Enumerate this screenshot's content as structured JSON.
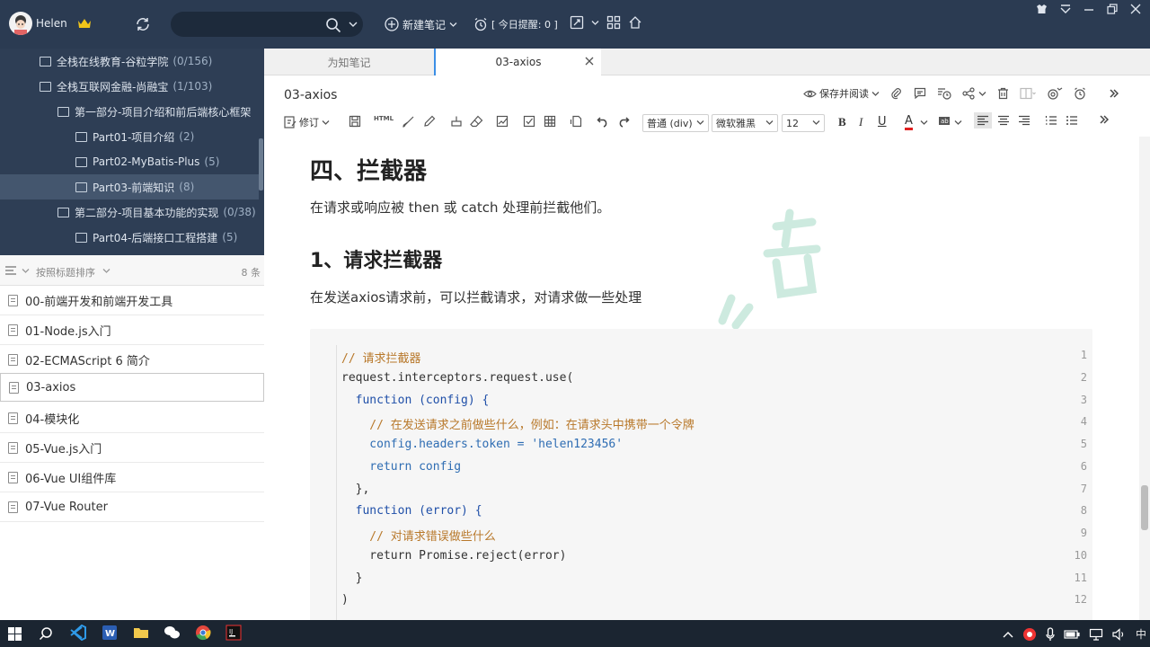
{
  "topbar": {
    "username": "Helen",
    "new_note_label": "新建笔记",
    "reminder_label": "[ 今日提醒: 0 ]"
  },
  "tree": {
    "items": [
      {
        "label": "全栈在线教育-谷粒学院",
        "count": "(0/156)",
        "level": 1
      },
      {
        "label": "全栈互联网金融-尚融宝",
        "count": "(1/103)",
        "level": 1
      },
      {
        "label": "第一部分-项目介绍和前后端核心框架",
        "count": "",
        "level": 2
      },
      {
        "label": "Part01-项目介绍",
        "count": "(2)",
        "level": 3
      },
      {
        "label": "Part02-MyBatis-Plus",
        "count": "(5)",
        "level": 3
      },
      {
        "label": "Part03-前端知识",
        "count": "(8)",
        "level": 3,
        "selected": true
      },
      {
        "label": "第二部分-项目基本功能的实现",
        "count": "(0/38)",
        "level": 2
      },
      {
        "label": "Part04-后端接口工程搭建",
        "count": "(5)",
        "level": 3
      }
    ]
  },
  "sortbar": {
    "label": "按照标题排序",
    "count": "8 条"
  },
  "notes": [
    {
      "title": "00-前端开发和前端开发工具"
    },
    {
      "title": "01-Node.js入门"
    },
    {
      "title": "02-ECMAScript 6 简介"
    },
    {
      "title": "03-axios",
      "selected": true
    },
    {
      "title": "04-模块化"
    },
    {
      "title": "05-Vue.js入门"
    },
    {
      "title": "06-Vue UI组件库"
    },
    {
      "title": "07-Vue Router"
    }
  ],
  "tabs": {
    "tab1": "为知笔记",
    "tab2": "03-axios"
  },
  "editor_header": {
    "title": "03-axios",
    "save_read_label": "保存并阅读"
  },
  "format_bar": {
    "revise_label": "修订",
    "paragraph_select": "普通 (div)",
    "font_select": "微软雅黑",
    "size_select": "12",
    "bold": "B",
    "italic": "I",
    "underline": "U",
    "font_color": "A",
    "html_label": "HTML"
  },
  "content": {
    "heading": "四、拦截器",
    "intro": "在请求或响应被 then 或 catch 处理前拦截他们。",
    "subheading": "1、请求拦截器",
    "sub_intro": "在发送axios请求前，可以拦截请求，对请求做一些处理"
  },
  "code": {
    "lines": [
      {
        "n": "1",
        "text": "// 请求拦截器"
      },
      {
        "n": "2",
        "text": "request.interceptors.request.use("
      },
      {
        "n": "3",
        "text": "  function (config) {"
      },
      {
        "n": "4",
        "text": "    // 在发送请求之前做些什么，例如：在请求头中携带一个令牌"
      },
      {
        "n": "5",
        "text": "    config.headers.token = 'helen123456'"
      },
      {
        "n": "6",
        "text": "    return config"
      },
      {
        "n": "7",
        "text": "  },"
      },
      {
        "n": "8",
        "text": "  function (error) {"
      },
      {
        "n": "9",
        "text": "    // 对请求错误做些什么"
      },
      {
        "n": "10",
        "text": "    return Promise.reject(error)"
      },
      {
        "n": "11",
        "text": "  }"
      },
      {
        "n": "12",
        "text": ")"
      }
    ]
  },
  "taskbar": {
    "ime_label": "中"
  },
  "colors": {
    "sidebar_bg": "#2e3e55",
    "topbar_bg": "#2b3b52",
    "accent": "#3b8fe6",
    "comment": "#b8782a",
    "keyword": "#1f4fa8",
    "string": "#a35a2a"
  }
}
